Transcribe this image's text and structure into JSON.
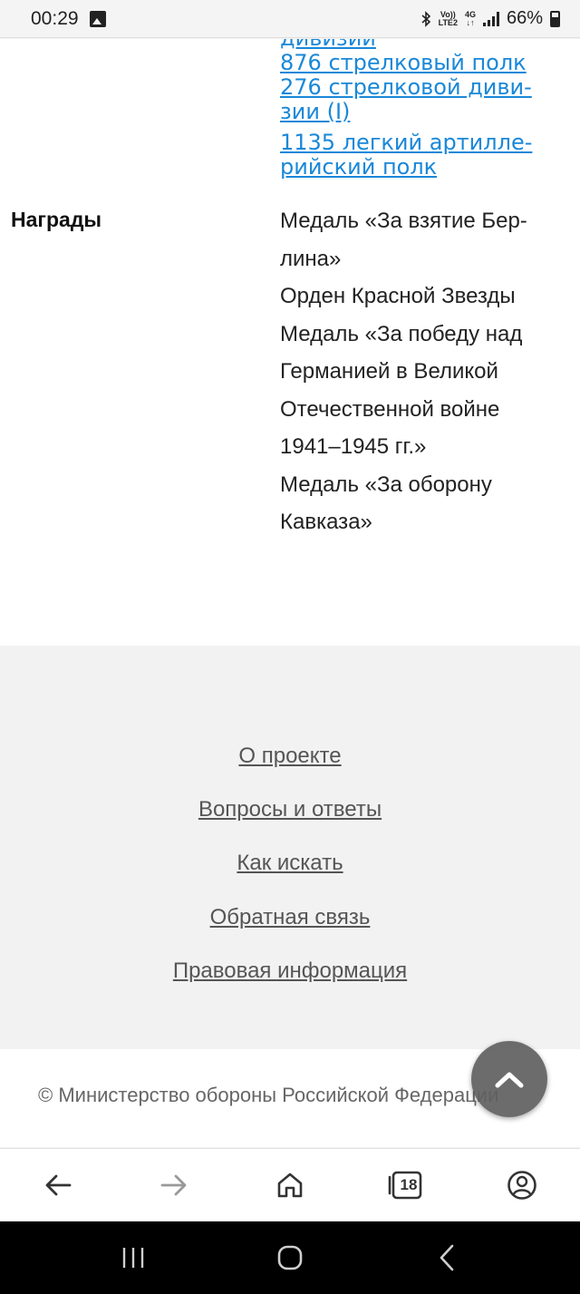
{
  "status": {
    "time": "00:29",
    "battery_text": "66%",
    "volte_top": "Vo))",
    "volte_bottom": "LTE2",
    "network": "4G"
  },
  "units": [
    "дивизии",
    "876 стрелковый полк",
    "276 стрелковой диви-",
    "зии (I)",
    "1135 легкий артилле-",
    "рийский полк"
  ],
  "awards": {
    "label": "Награды",
    "items": [
      "Медаль «За взятие Бер-",
      "лина»",
      "Орден Красной Звезды",
      "Медаль «За победу над",
      "Германией в Великой",
      "Отечественной войне",
      "1941–1945 гг.»",
      "Медаль «За оборону",
      "Кавказа»"
    ]
  },
  "footer": {
    "links": [
      "О проекте",
      "Вопросы и ответы",
      "Как искать",
      "Обратная связь",
      "Правовая информация"
    ],
    "copyright": "© Министерство обороны Российской Федерации"
  },
  "browser": {
    "tab_count": "18"
  },
  "colors": {
    "link": "#1a88d8",
    "footer_link": "#555555",
    "scroll_button": "#606060"
  }
}
